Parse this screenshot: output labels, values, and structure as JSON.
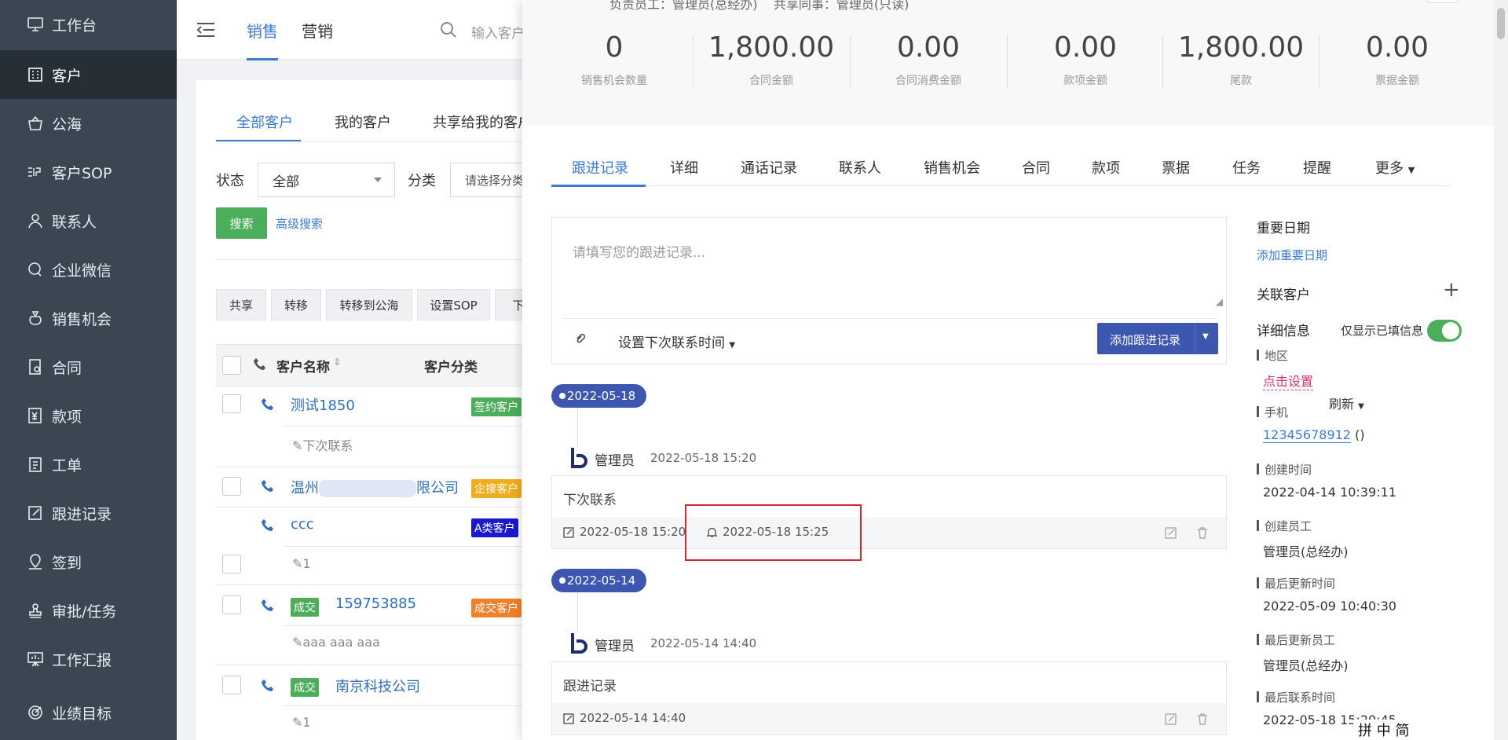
{
  "sidebar": {
    "items": [
      {
        "label": "工作台",
        "icon": "monitor-icon"
      },
      {
        "label": "客户",
        "icon": "building-icon"
      },
      {
        "label": "公海",
        "icon": "basket-icon"
      },
      {
        "label": "客户SOP",
        "icon": "sop-icon"
      },
      {
        "label": "联系人",
        "icon": "person-icon"
      },
      {
        "label": "企业微信",
        "icon": "chat-icon"
      },
      {
        "label": "销售机会",
        "icon": "money-bag-icon"
      },
      {
        "label": "合同",
        "icon": "contract-icon"
      },
      {
        "label": "款项",
        "icon": "yen-icon"
      },
      {
        "label": "工单",
        "icon": "clipboard-icon"
      },
      {
        "label": "跟进记录",
        "icon": "edit-icon"
      },
      {
        "label": "签到",
        "icon": "location-icon"
      },
      {
        "label": "审批/任务",
        "icon": "stamp-icon"
      },
      {
        "label": "工作汇报",
        "icon": "report-icon"
      },
      {
        "label": "业绩目标",
        "icon": "target-icon"
      }
    ]
  },
  "topbar": {
    "tabs": [
      "销售",
      "营销"
    ],
    "search_placeholder": "输入客户"
  },
  "list": {
    "sub_tabs": [
      "全部客户",
      "我的客户",
      "共享给我的客户"
    ],
    "status_label": "状态",
    "status_value": "全部",
    "category_label": "分类",
    "category_placeholder": "请选择分类",
    "search_btn": "搜索",
    "advanced_search": "高级搜索",
    "tools": [
      "共享",
      "转移",
      "转移到公海",
      "设置SOP",
      "下"
    ],
    "col_name": "客户名称",
    "col_category": "客户分类",
    "rows": [
      {
        "name": "测试1850",
        "tag": "签约客户",
        "tag_color": "#4cae5b",
        "badge": "",
        "sub": "下次联系"
      },
      {
        "name_pre": "温州",
        "name_post": "限公司",
        "tag": "企搜客户",
        "tag_color": "#f0ad1e",
        "badge": "",
        "sub": ""
      },
      {
        "name": "ccc",
        "tag": "A类客户",
        "tag_color": "#1a1acc",
        "badge": "",
        "sub": "1"
      },
      {
        "name": "159753885",
        "tag": "成交客户",
        "tag_color": "#f0812a",
        "badge": "成交",
        "sub": "aaa aaa aaa"
      },
      {
        "name": "南京科技公司",
        "tag": "",
        "tag_color": "",
        "badge": "成交",
        "sub": "1"
      }
    ]
  },
  "drawer": {
    "owner_line": "负责员工：管理员(总经办)    共享同事：管理员(只读)",
    "stats": [
      {
        "value": "0",
        "label": "销售机会数量"
      },
      {
        "value": "1,800.00",
        "label": "合同金额"
      },
      {
        "value": "0.00",
        "label": "合同消费金额"
      },
      {
        "value": "0.00",
        "label": "款项金额"
      },
      {
        "value": "1,800.00",
        "label": "尾款"
      },
      {
        "value": "0.00",
        "label": "票据金额"
      }
    ],
    "tabs": [
      "跟进记录",
      "详细",
      "通话记录",
      "联系人",
      "销售机会",
      "合同",
      "款项",
      "票据",
      "任务",
      "提醒",
      "更多"
    ],
    "followup_placeholder": "请填写您的跟进记录...",
    "next_contact": "设置下次联系时间",
    "add_record": "添加跟进记录",
    "refresh": "刷新",
    "records": [
      {
        "date": "2022-05-18",
        "user": "管理员",
        "time": "2022-05-18 15:20",
        "content": "下次联系",
        "created": "2022-05-18 15:20",
        "remind": "2022-05-18 15:25"
      },
      {
        "date": "2022-05-14",
        "user": "管理员",
        "time": "2022-05-14 14:40",
        "content": "跟进记录",
        "created": "2022-05-14 14:40",
        "remind": ""
      }
    ],
    "right": {
      "important_date": "重要日期",
      "add_important_date": "添加重要日期",
      "related_customer": "关联客户",
      "detail_info": "详细信息",
      "only_filled": "仅显示已填信息",
      "region_label": "地区",
      "region_value": "点击设置",
      "phone_label": "手机",
      "phone_value": "12345678912",
      "phone_suffix": " ()",
      "created_time_label": "创建时间",
      "created_time_value": "2022-04-14 10:39:11",
      "creator_label": "创建员工",
      "creator_value": "管理员(总经办)",
      "updated_time_label": "最后更新时间",
      "updated_time_value": "2022-05-09 10:40:30",
      "updater_label": "最后更新员工",
      "updater_value": "管理员(总经办)",
      "last_contact_label": "最后联系时间",
      "last_contact_value": "2022-05-18 15:20:45"
    },
    "ime_bar": "拼 中 简"
  },
  "colors": {
    "sidebar_bg": "#3a4652",
    "accent": "#3a7bd5",
    "pill": "#3d56b0",
    "highlight_box": "#d9232e"
  }
}
